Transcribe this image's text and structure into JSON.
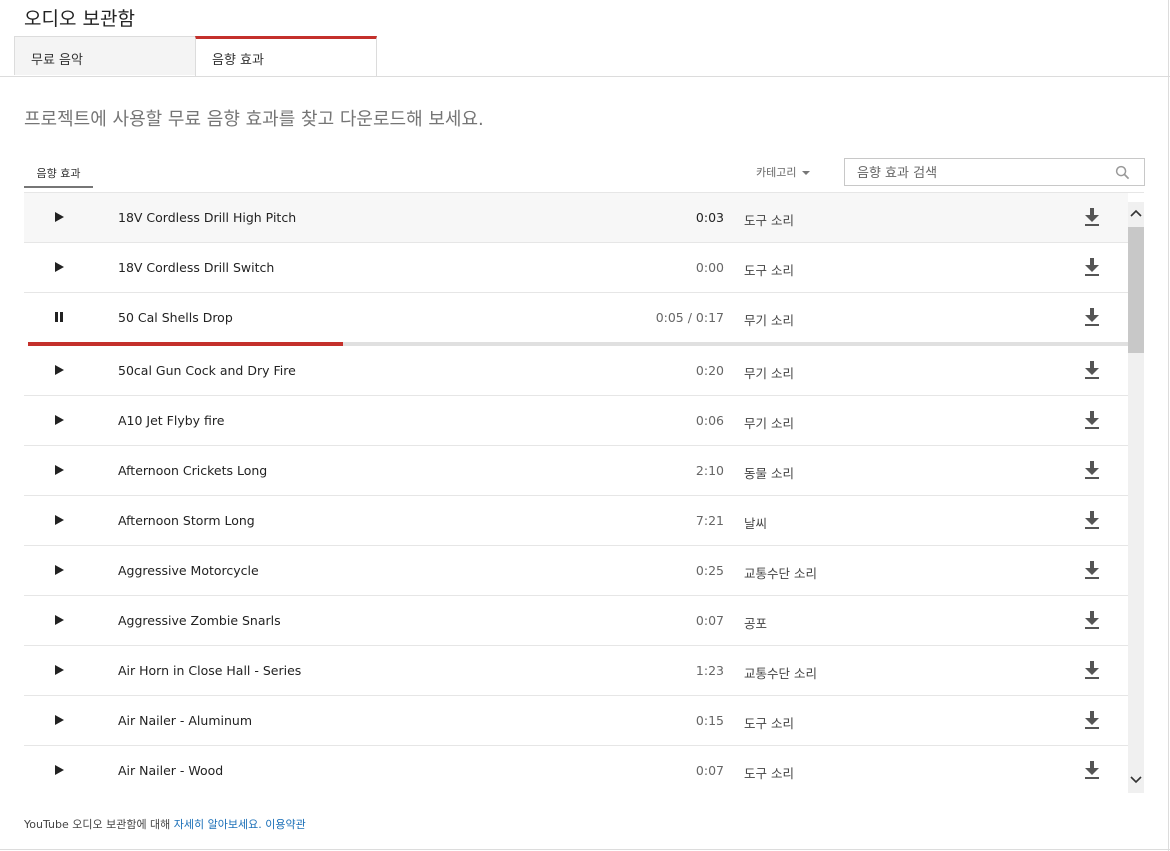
{
  "page": {
    "title": "오디오 보관함"
  },
  "tabs": [
    {
      "label": "무료 음악"
    },
    {
      "label": "음향 효과"
    }
  ],
  "active_tab": 1,
  "subtitle": "프로젝트에 사용할 무료 음향 효과를 찾고 다운로드해 보세요.",
  "toolbar": {
    "sub_tab": "음향 효과",
    "category_label": "카테고리",
    "search_placeholder": "음향 효과 검색"
  },
  "tracks": [
    {
      "name": "18V Cordless Drill High Pitch",
      "duration": "0:03",
      "category": "도구 소리"
    },
    {
      "name": "18V Cordless Drill Switch",
      "duration": "0:00",
      "category": "도구 소리"
    },
    {
      "name": "50 Cal Shells Drop",
      "duration": "0:05 / 0:17",
      "category": "무기 소리",
      "playing": true,
      "progress": 0.286
    },
    {
      "name": "50cal Gun Cock and Dry Fire",
      "duration": "0:20",
      "category": "무기 소리"
    },
    {
      "name": "A10 Jet Flyby fire",
      "duration": "0:06",
      "category": "무기 소리"
    },
    {
      "name": "Afternoon Crickets Long",
      "duration": "2:10",
      "category": "동물 소리"
    },
    {
      "name": "Afternoon Storm Long",
      "duration": "7:21",
      "category": "날씨"
    },
    {
      "name": "Aggressive Motorcycle",
      "duration": "0:25",
      "category": "교통수단 소리"
    },
    {
      "name": "Aggressive Zombie Snarls",
      "duration": "0:07",
      "category": "공포"
    },
    {
      "name": "Air Horn in Close Hall - Series",
      "duration": "1:23",
      "category": "교통수단 소리"
    },
    {
      "name": "Air Nailer - Aluminum",
      "duration": "0:15",
      "category": "도구 소리"
    },
    {
      "name": "Air Nailer - Wood",
      "duration": "0:07",
      "category": "도구 소리"
    }
  ],
  "footer": {
    "text": "YouTube 오디오 보관함에 대해 ",
    "learn_more": "자세히 알아보세요.",
    "terms": "이용약관"
  },
  "colors": {
    "accent": "#c4302b",
    "link": "#1a6fb8"
  },
  "icons": {
    "play": "play-icon",
    "pause": "pause-icon",
    "download": "download-icon",
    "search": "search-icon"
  }
}
